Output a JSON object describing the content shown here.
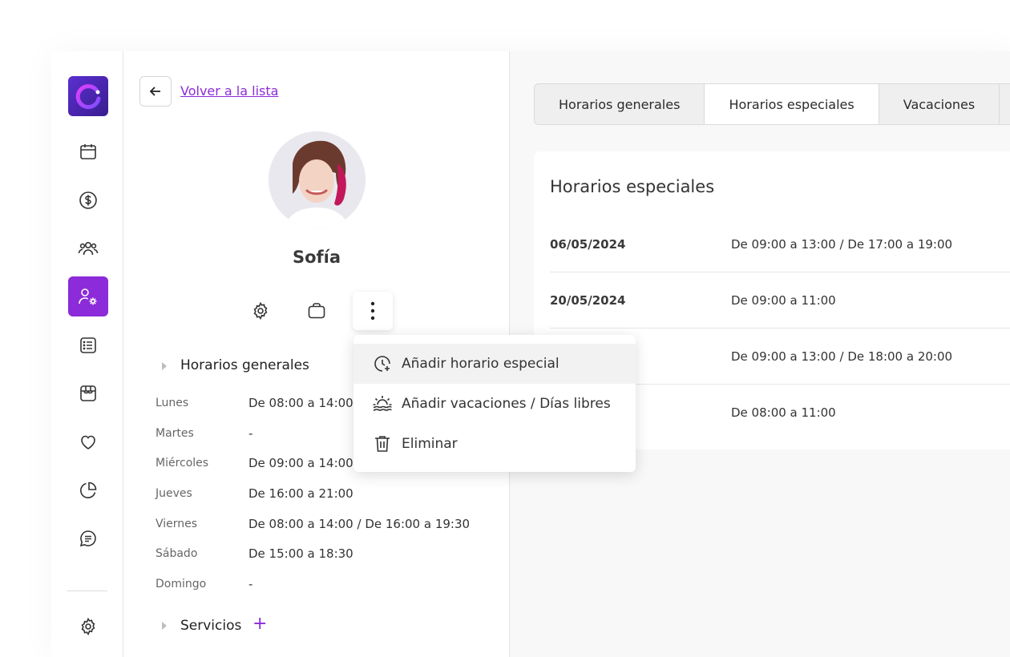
{
  "nav": {
    "back_link": "Volver a la lista"
  },
  "profile": {
    "name": "Sofía"
  },
  "general": {
    "title": "Horarios generales",
    "rows": [
      {
        "day": "Lunes",
        "hours": "De 08:00 a 14:00"
      },
      {
        "day": "Martes",
        "hours": "-"
      },
      {
        "day": "Miércoles",
        "hours": "De 09:00 a 14:00"
      },
      {
        "day": "Jueves",
        "hours": "De 16:00 a 21:00"
      },
      {
        "day": "Viernes",
        "hours": "De 08:00 a 14:00 / De 16:00 a 19:30"
      },
      {
        "day": "Sábado",
        "hours": "De 15:00 a 18:30"
      },
      {
        "day": "Domingo",
        "hours": "-"
      }
    ]
  },
  "services": {
    "title": "Servicios",
    "add": "+"
  },
  "tabs": [
    {
      "label": "Horarios generales"
    },
    {
      "label": "Horarios especiales"
    },
    {
      "label": "Vacaciones"
    }
  ],
  "special": {
    "title": "Horarios especiales",
    "rows": [
      {
        "date": "06/05/2024",
        "hours": "De 09:00 a 13:00 / De 17:00 a 19:00"
      },
      {
        "date": "20/05/2024",
        "hours": "De 09:00 a 11:00"
      },
      {
        "date": "",
        "hours": "De 09:00 a 13:00 / De 18:00 a 20:00"
      },
      {
        "date": "",
        "hours": "De 08:00 a 11:00"
      }
    ]
  },
  "menu": {
    "items": [
      {
        "label": "Añadir horario especial",
        "icon": "clock-plus-icon"
      },
      {
        "label": "Añadir vacaciones / Días libres",
        "icon": "sunset-icon"
      },
      {
        "label": "Eliminar",
        "icon": "trash-icon"
      }
    ]
  },
  "colors": {
    "accent": "#8b2bd9",
    "logo": "#4a25b0"
  }
}
